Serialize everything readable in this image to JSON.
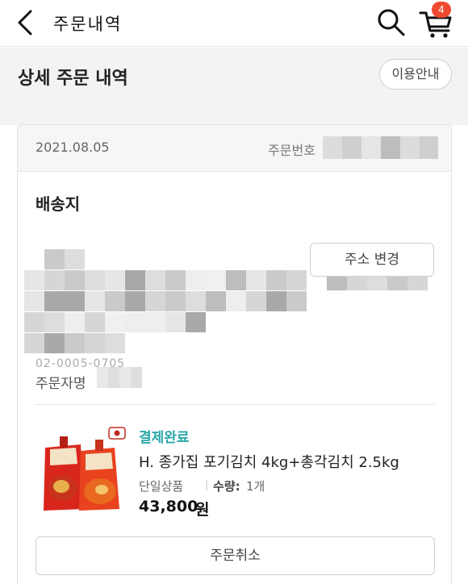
{
  "header": {
    "title": "주문내역",
    "cart_count": "4",
    "icons": {
      "back": "chevron-left-icon",
      "search": "search-icon",
      "cart": "cart-icon"
    }
  },
  "title_bar": {
    "page_title": "상세 주문 내역",
    "guide_label": "이용안내"
  },
  "order": {
    "date": "2021.08.05",
    "number_label": "주문번호"
  },
  "shipping": {
    "title": "배송지",
    "change_address_label": "주소 변경",
    "phone_partial": "02-0005-0705",
    "orderer_label": "주문자명"
  },
  "product": {
    "status": "결제완료",
    "name": "H. 종가집 포기김치 4kg+총각김치 2.5kg",
    "type": "단일상품",
    "qty_label": "수량:",
    "qty_value": "1개",
    "price": "43,800",
    "price_unit": "원"
  },
  "actions": {
    "cancel_label": "주문취소"
  },
  "colors": {
    "accent_status": "#2aa7a8",
    "badge": "#ee4a2f"
  }
}
